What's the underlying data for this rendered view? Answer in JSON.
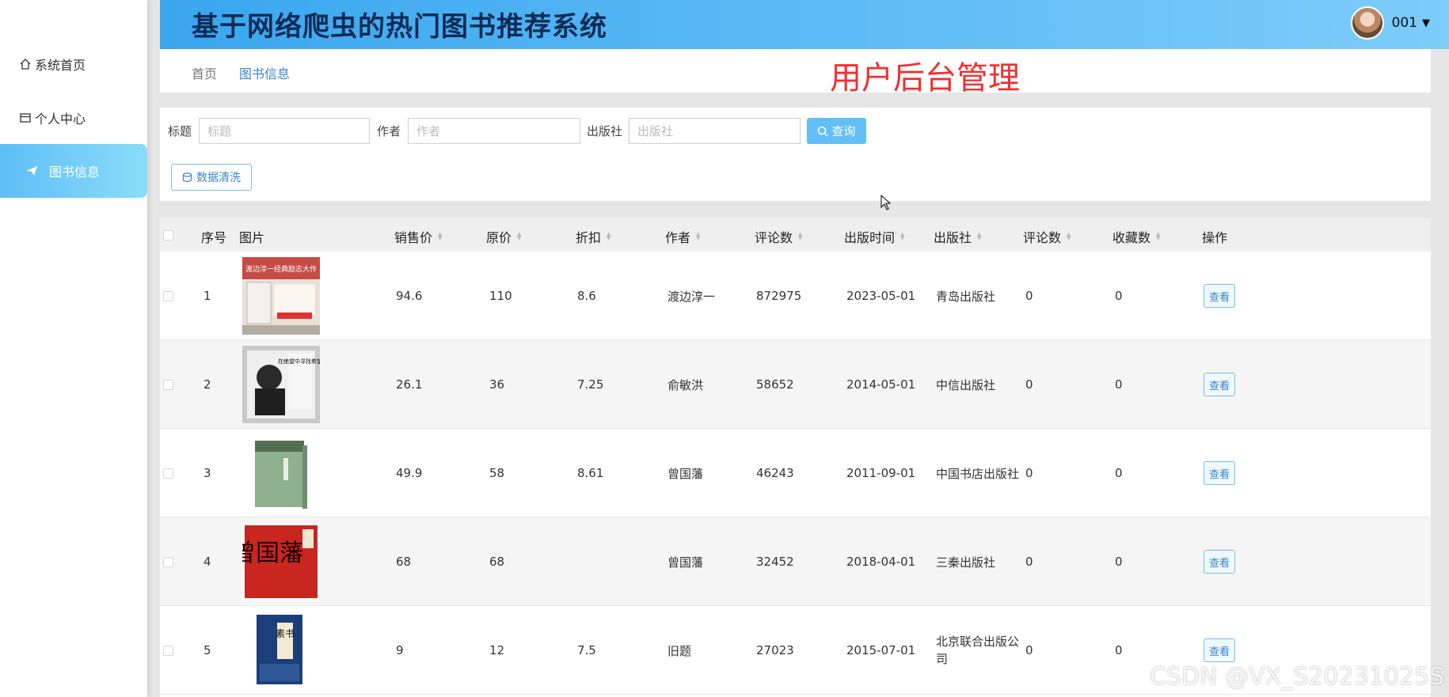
{
  "sidebar": {
    "items": [
      {
        "label": "系统首页",
        "icon": "home-icon"
      },
      {
        "label": "个人中心",
        "icon": "user-card-icon"
      },
      {
        "label": "图书信息",
        "icon": "paper-plane-icon",
        "active": true
      }
    ]
  },
  "header": {
    "title": "基于网络爬虫的热门图书推荐系统",
    "username": "001"
  },
  "breadcrumb": {
    "home": "首页",
    "current": "图书信息"
  },
  "admin_label": "用户后台管理",
  "search": {
    "title_label": "标题",
    "title_placeholder": "标题",
    "author_label": "作者",
    "author_placeholder": "作者",
    "publisher_label": "出版社",
    "publisher_placeholder": "出版社",
    "query_button": "查询",
    "clean_button": "数据清洗"
  },
  "table": {
    "headers": {
      "index": "序号",
      "image": "图片",
      "price": "销售价",
      "original": "原价",
      "discount": "折扣",
      "author": "作者",
      "comments": "评论数",
      "pubdate": "出版时间",
      "publisher": "出版社",
      "comments2": "评论数",
      "favorites": "收藏数",
      "actions": "操作"
    },
    "view_label": "查看",
    "rows": [
      {
        "index": "1",
        "price": "94.6",
        "original": "110",
        "discount": "8.6",
        "author": "渡边淳一",
        "comments": "872975",
        "pubdate": "2023-05-01",
        "publisher": "青岛出版社",
        "comments2": "0",
        "favorites": "0",
        "cover_text": "渡边淳一经典励志大作"
      },
      {
        "index": "2",
        "price": "26.1",
        "original": "36",
        "discount": "7.25",
        "author": "俞敏洪",
        "comments": "58652",
        "pubdate": "2014-05-01",
        "publisher": "中信出版社",
        "comments2": "0",
        "favorites": "0",
        "cover_text": "在绝望中寻找希望"
      },
      {
        "index": "3",
        "price": "49.9",
        "original": "58",
        "discount": "8.61",
        "author": "曾国藩",
        "comments": "46243",
        "pubdate": "2011-09-01",
        "publisher": "中国书店出版社",
        "comments2": "0",
        "favorites": "0",
        "cover_text": ""
      },
      {
        "index": "4",
        "price": "68",
        "original": "68",
        "discount": "",
        "author": "曾国藩",
        "comments": "32452",
        "pubdate": "2018-04-01",
        "publisher": "三秦出版社",
        "comments2": "0",
        "favorites": "0",
        "cover_text": "曾国藩"
      },
      {
        "index": "5",
        "price": "9",
        "original": "12",
        "discount": "7.5",
        "author": "旧题",
        "comments": "27023",
        "pubdate": "2015-07-01",
        "publisher": "北京联合出版公司",
        "comments2": "0",
        "favorites": "0",
        "cover_text": "素书"
      }
    ]
  },
  "watermark": "CSDN @VX_S20231025S",
  "colors": {
    "header_gradient_start": "#38a6ee",
    "header_gradient_end": "#7dccfa",
    "accent": "#3a86c8",
    "admin_label": "#f0302e",
    "title": "#0e2a55"
  }
}
